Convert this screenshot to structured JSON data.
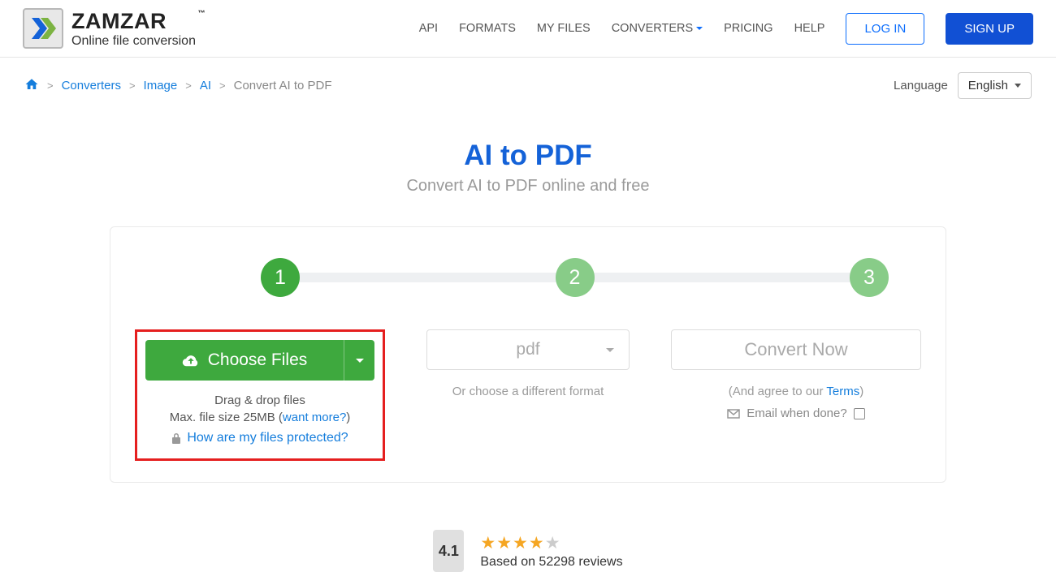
{
  "logo": {
    "main": "ZAMZAR",
    "tm": "™",
    "sub": "Online file conversion"
  },
  "nav": {
    "api": "API",
    "formats": "FORMATS",
    "myfiles": "MY FILES",
    "converters": "CONVERTERS",
    "pricing": "PRICING",
    "help": "HELP",
    "login": "LOG IN",
    "signup": "SIGN UP"
  },
  "breadcrumb": {
    "converters": "Converters",
    "image": "Image",
    "ai": "AI",
    "current": "Convert AI to PDF"
  },
  "language": {
    "label": "Language",
    "value": "English"
  },
  "hero": {
    "title": "AI to PDF",
    "sub": "Convert AI to PDF online and free"
  },
  "steps": {
    "s1": "1",
    "s2": "2",
    "s3": "3"
  },
  "col1": {
    "choose": "Choose Files",
    "drag": "Drag & drop files",
    "maxsize_prefix": "Max. file size 25MB (",
    "wantmore": "want more?",
    "maxsize_suffix": ")",
    "protected": "How are my files protected?"
  },
  "col2": {
    "format": "pdf",
    "hint": "Or choose a different format"
  },
  "col3": {
    "convert": "Convert Now",
    "agree_prefix": "(And agree to our ",
    "terms": "Terms",
    "agree_suffix": ")",
    "email": "Email when done?"
  },
  "rating": {
    "score": "4.1",
    "reviews": "Based on 52298 reviews"
  }
}
